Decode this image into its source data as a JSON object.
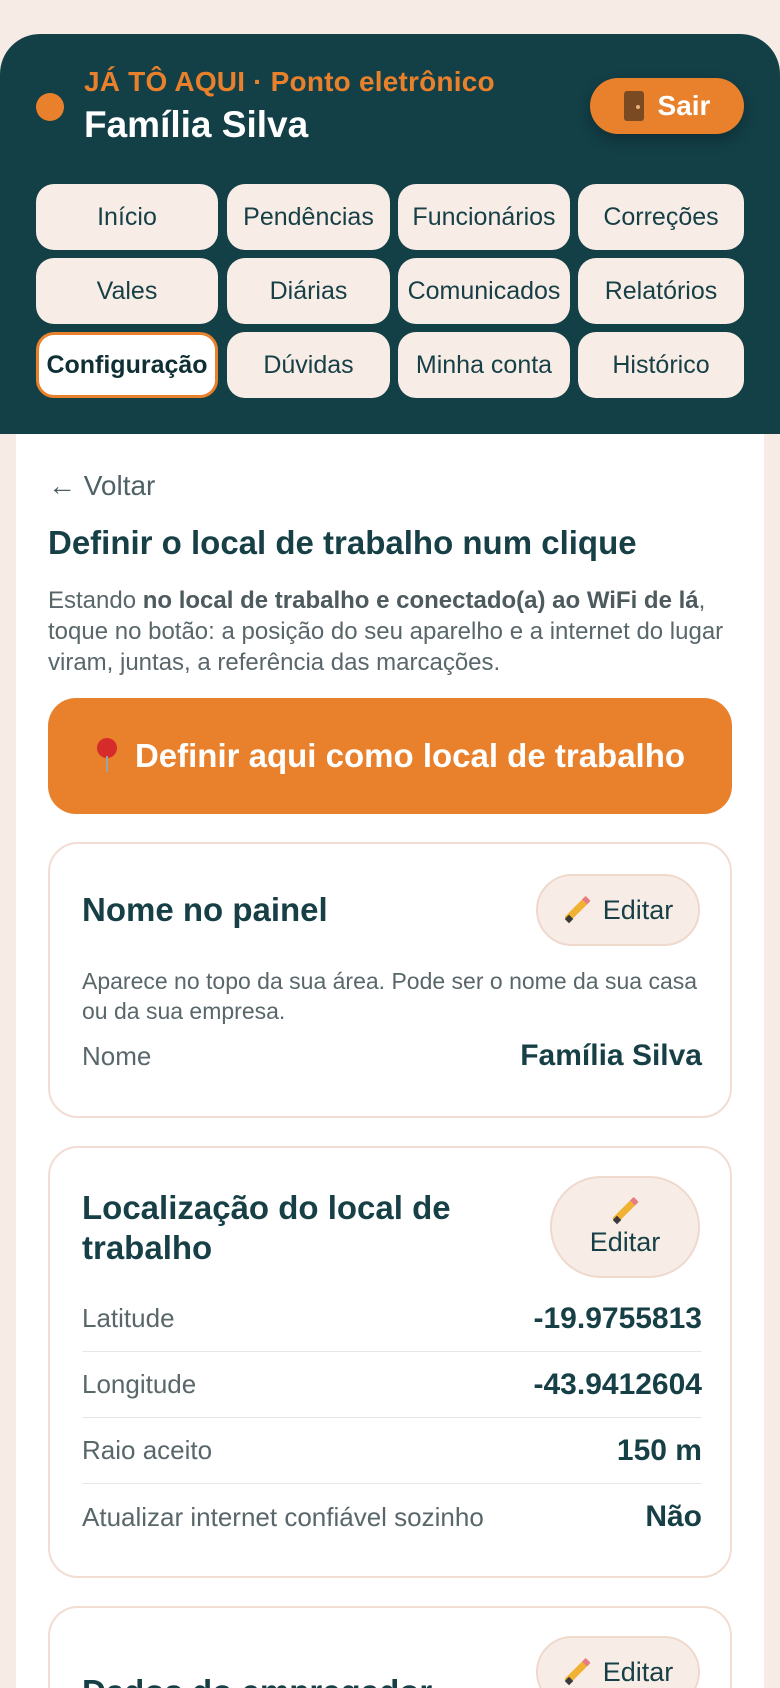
{
  "header": {
    "app_name": "JÁ TÔ AQUI · Ponto eletrônico",
    "household_name": "Família Silva",
    "logout_label": "Sair",
    "logout_icon": "door-icon",
    "accent_color": "#e9802b",
    "header_color": "#133f47"
  },
  "nav": {
    "items": [
      {
        "label": "Início"
      },
      {
        "label": "Pendências"
      },
      {
        "label": "Funcionários"
      },
      {
        "label": "Correções"
      },
      {
        "label": "Vales"
      },
      {
        "label": "Diárias"
      },
      {
        "label": "Comunicados"
      },
      {
        "label": "Relatórios"
      },
      {
        "label": "Configuração",
        "active": true
      },
      {
        "label": "Dúvidas"
      },
      {
        "label": "Minha conta"
      },
      {
        "label": "Histórico"
      }
    ]
  },
  "page": {
    "back_label": "← Voltar",
    "title": "Definir o local de trabalho num clique",
    "intro_prefix": "Estando ",
    "intro_bold": "no local de trabalho e conectado(a) ao WiFi de lá",
    "intro_suffix": ", toque no botão: a posição do seu aparelho e a internet do lugar viram, juntas, a referência das marcações.",
    "primary_button_label": "Definir aqui como local de trabalho",
    "primary_button_icon": "pin-icon"
  },
  "cards": {
    "name": {
      "title": "Nome no painel",
      "edit_label": "Editar",
      "description": "Aparece no topo da sua área. Pode ser o nome da sua casa ou da sua empresa.",
      "row_label": "Nome",
      "row_value": "Família Silva"
    },
    "location": {
      "title": "Localização do local de trabalho",
      "edit_label": "Editar",
      "rows": [
        {
          "label": "Latitude",
          "value": "-19.9755813"
        },
        {
          "label": "Longitude",
          "value": "-43.9412604"
        },
        {
          "label": "Raio aceito",
          "value": "150 m"
        },
        {
          "label": "Atualizar internet confiável sozinho",
          "value": "Não"
        }
      ]
    },
    "employer": {
      "title": "Dados do empregador",
      "edit_label": "Editar"
    }
  }
}
